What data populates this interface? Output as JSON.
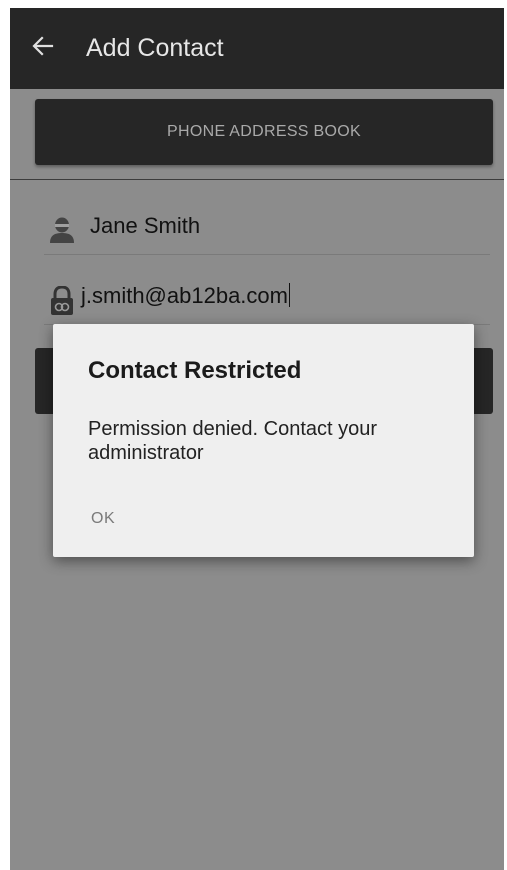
{
  "appbar": {
    "title": "Add Contact",
    "back_icon": "arrow-left-icon"
  },
  "phone_address_book_button": {
    "label": "PHONE ADDRESS BOOK"
  },
  "fields": {
    "name": {
      "value": "Jane Smith",
      "icon": "person-icon"
    },
    "email": {
      "value": "j.smith@ab12ba.com",
      "icon": "lock-icon"
    }
  },
  "dialog": {
    "title": "Contact Restricted",
    "message": "Permission denied. Contact your administrator",
    "ok_label": "OK"
  },
  "colors": {
    "appbar": "#262626",
    "scrim": "#8c8c8c",
    "dialog": "#efefef"
  }
}
